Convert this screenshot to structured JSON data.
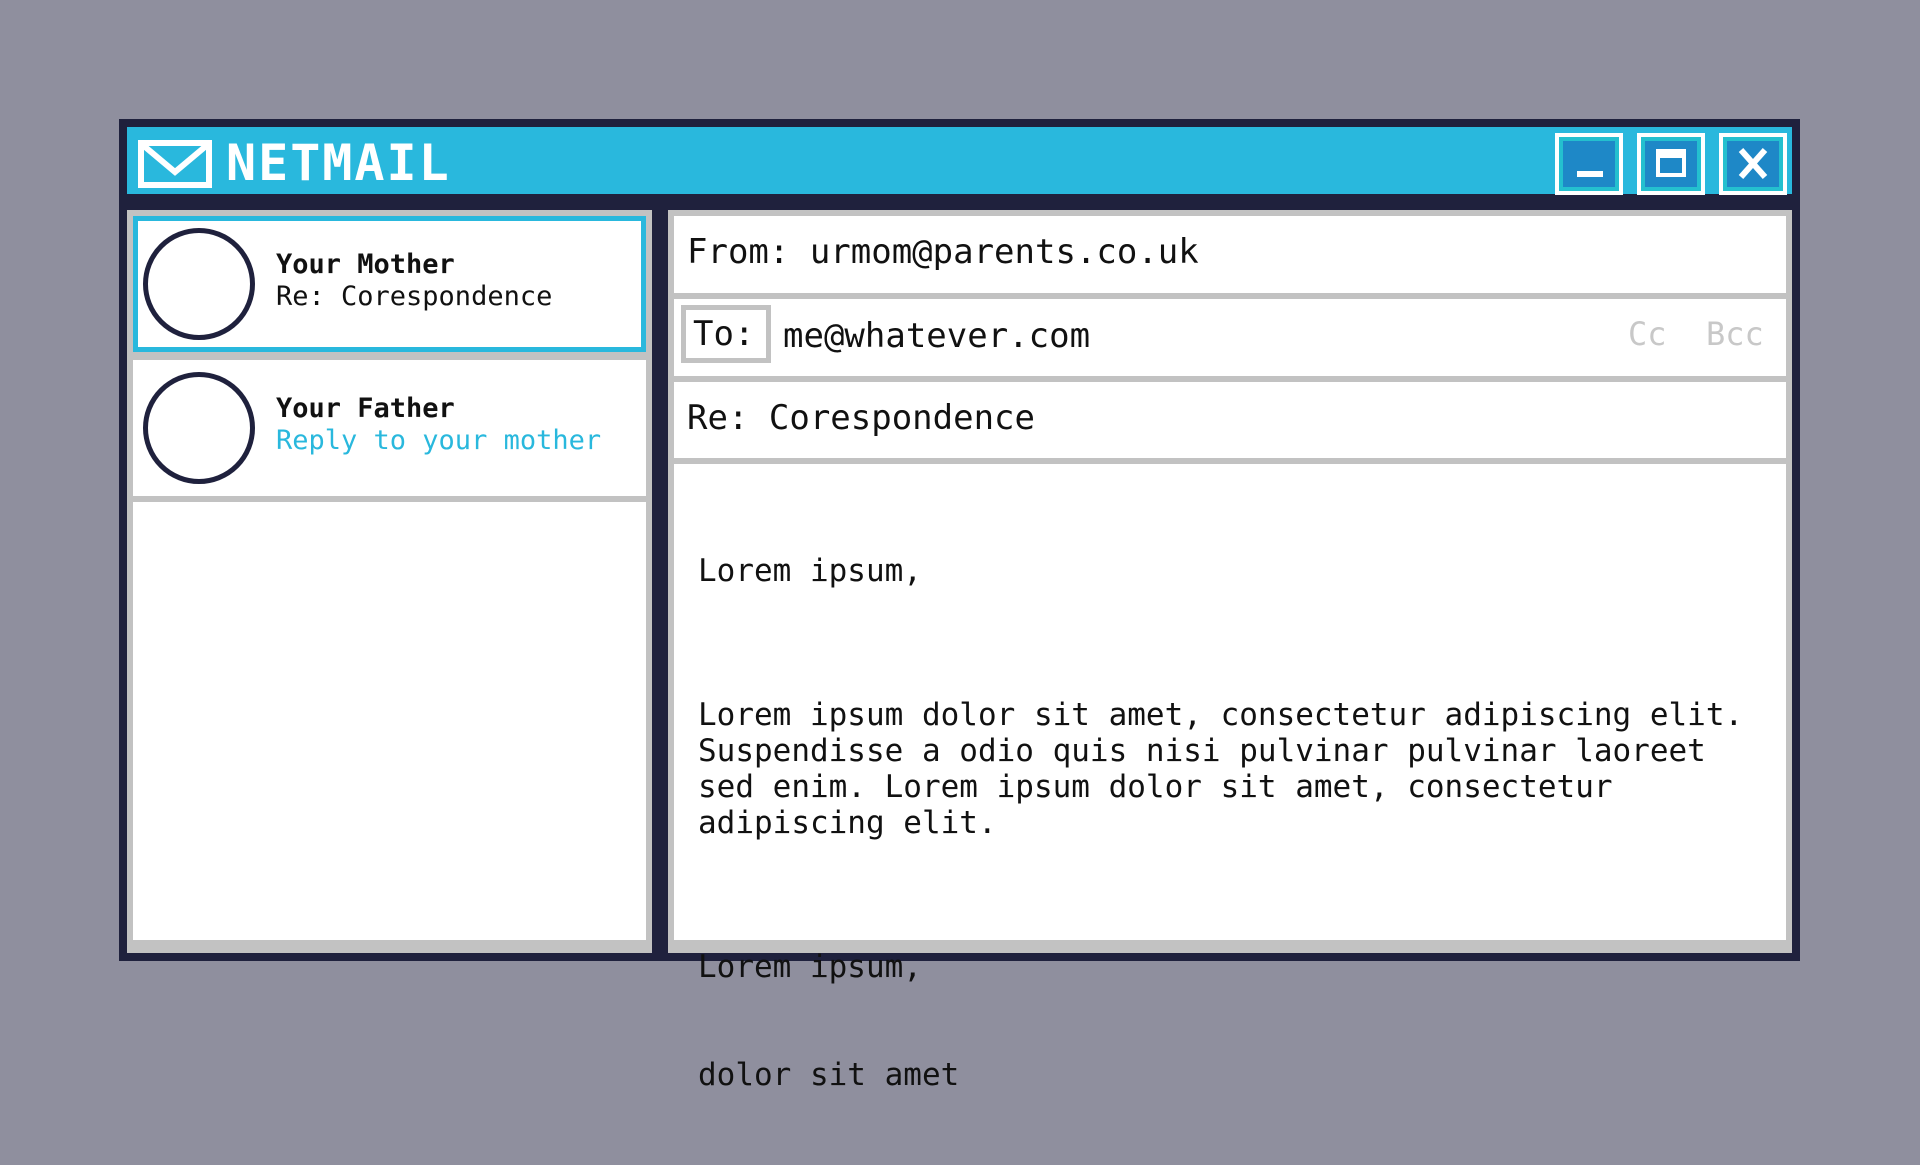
{
  "app": {
    "title": "NETMAIL"
  },
  "window_buttons": {
    "minimize_icon": "minimize-icon",
    "maximize_icon": "maximize-icon",
    "close_icon": "close-icon"
  },
  "colors": {
    "accent": "#29b8dd",
    "frame": "#1f213d",
    "background": "#8f8f9e"
  },
  "inbox": {
    "items": [
      {
        "sender": "Your Mother",
        "subject": "Re: Corespondence",
        "active": true
      },
      {
        "sender": "Your Father",
        "subject": "Reply to your mother",
        "active": false
      }
    ]
  },
  "message": {
    "from_label": "From: urmom@parents.co.uk",
    "to_label": "To:",
    "to_value": "me@whatever.com",
    "cc_label": "Cc",
    "bcc_label": "Bcc",
    "subject": "Re: Corespondence",
    "body": {
      "greeting": "Lorem ipsum,",
      "paragraph": "Lorem ipsum dolor sit amet, consectetur adipiscing elit. Suspendisse a odio quis nisi pulvinar pulvinar laoreet sed enim. Lorem ipsum dolor sit amet, consectetur adipiscing elit.",
      "signoff_1": "Lorem ipsum,",
      "signoff_2": "dolor sit amet"
    }
  }
}
